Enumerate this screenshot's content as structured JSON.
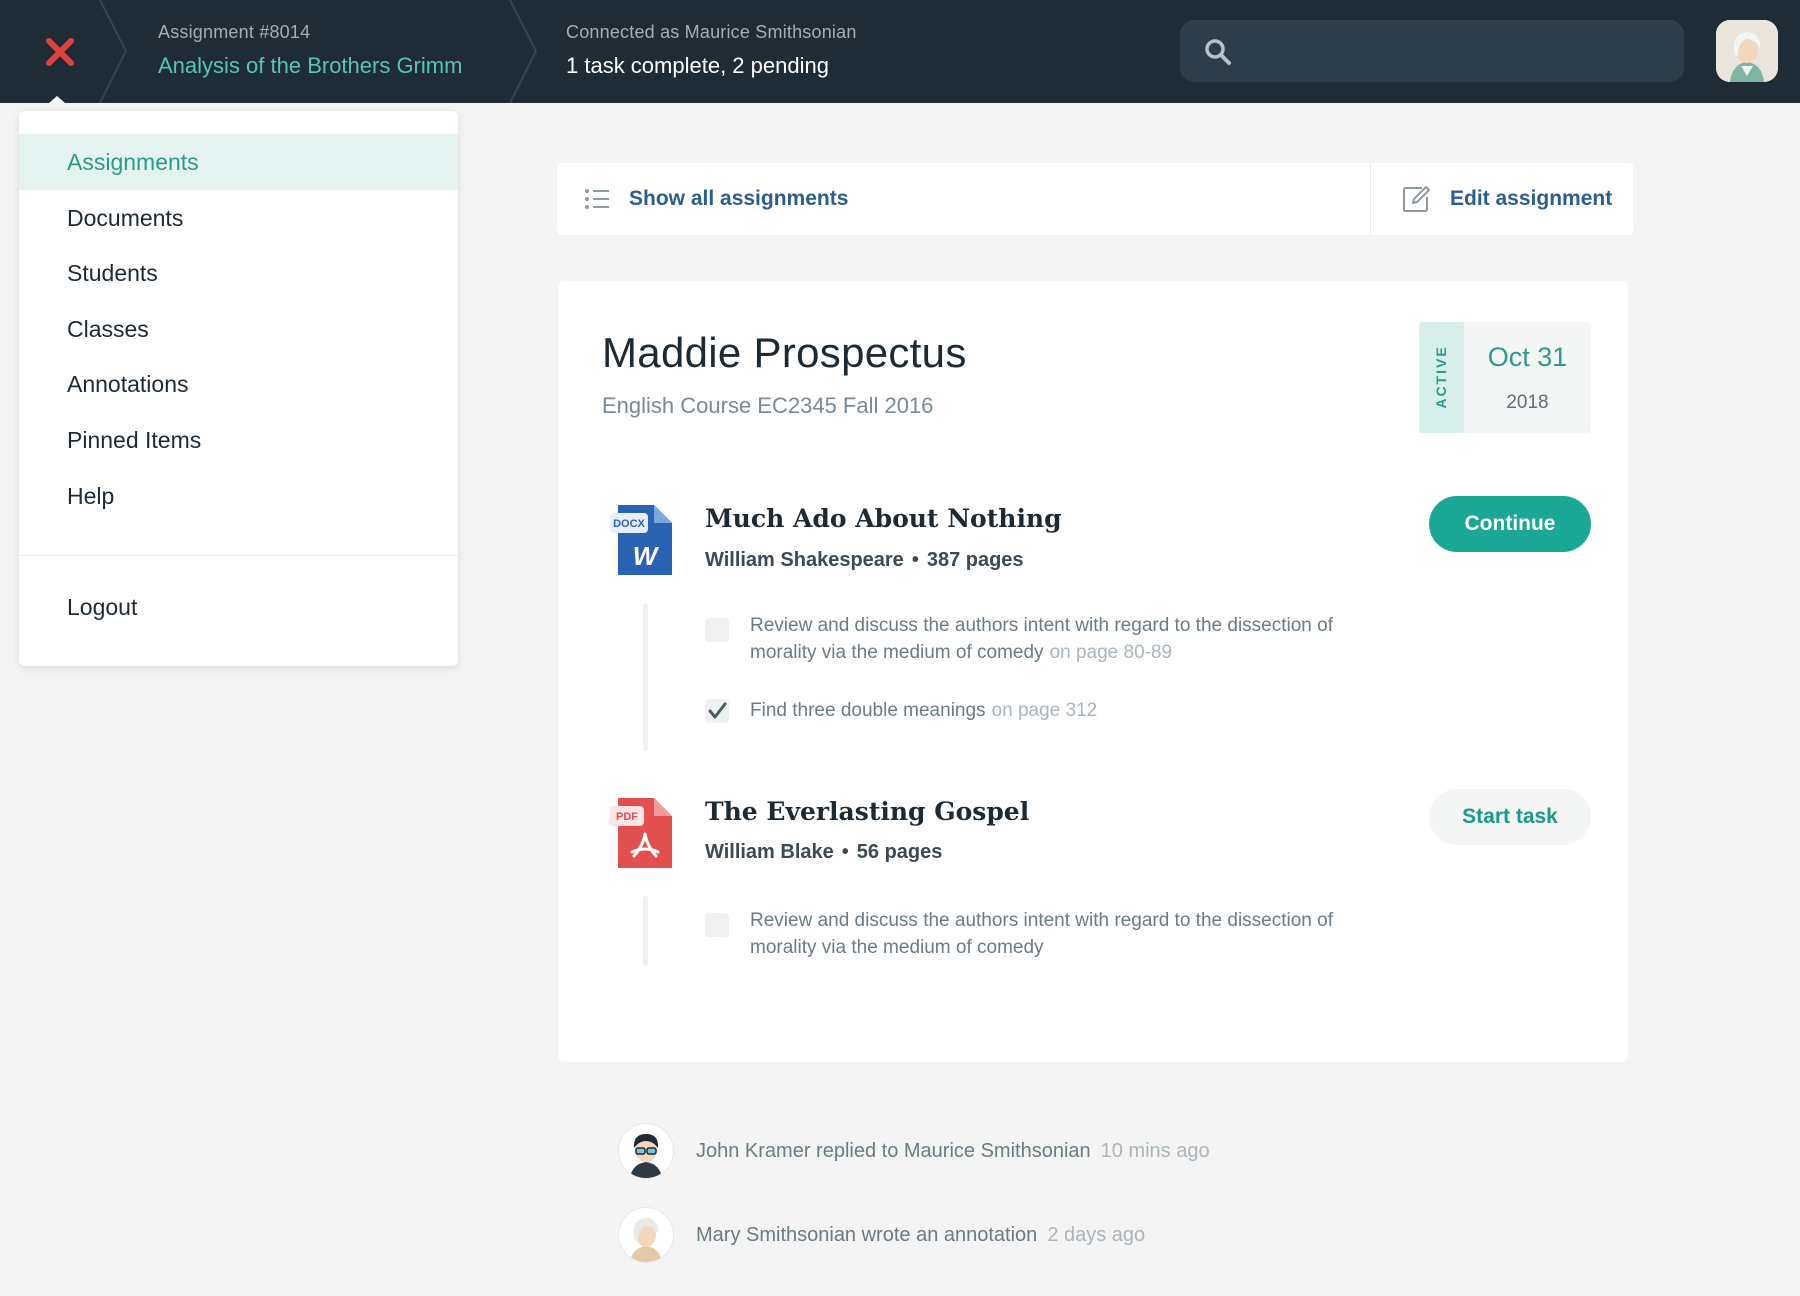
{
  "header": {
    "close_icon": "close-icon",
    "assignment_number": "Assignment #8014",
    "assignment_title": "Analysis of the Brothers Grimm",
    "connection_text": "Connected as Maurice Smithsonian",
    "task_status": "1 task complete, 2 pending",
    "search": {
      "placeholder": "",
      "value": "",
      "icon": "search-icon"
    },
    "avatar": "user-avatar",
    "colors": {
      "bar": "#1f2c36",
      "accent": "#55c5b5",
      "close": "#e0433b"
    }
  },
  "sidebar": {
    "items": [
      {
        "label": "Assignments",
        "active": true
      },
      {
        "label": "Documents"
      },
      {
        "label": "Students"
      },
      {
        "label": "Classes"
      },
      {
        "label": "Annotations"
      },
      {
        "label": "Pinned Items"
      },
      {
        "label": "Help"
      }
    ],
    "logout": "Logout"
  },
  "actionbar": {
    "show_all": "Show all assignments",
    "show_all_icon": "list-icon",
    "edit": "Edit assignment",
    "edit_icon": "edit-icon"
  },
  "assignment": {
    "title": "Maddie Prospectus",
    "course": "English Course EC2345 Fall 2016",
    "status": "ACTIVE",
    "date": "Oct 31",
    "year": "2018",
    "documents": [
      {
        "type_badge": "DOCX",
        "type_letter": "W",
        "title": "Much Ado About Nothing",
        "author": "William Shakespeare",
        "pages": "387 pages",
        "action": "Continue",
        "tasks": [
          {
            "text": "Review and discuss the authors intent with regard to the dissection of morality via the medium of comedy",
            "page": "on page 80-89",
            "checked": false
          },
          {
            "text": "Find three double meanings",
            "page": "on page 312",
            "checked": true
          }
        ]
      },
      {
        "type_badge": "PDF",
        "title": "The Everlasting Gospel",
        "author": "William Blake",
        "pages": "56 pages",
        "action": "Start task",
        "tasks": [
          {
            "text": "Review and discuss the authors intent with regard to the dissection of morality via the medium of comedy",
            "page": "",
            "checked": false
          }
        ]
      }
    ]
  },
  "activity": [
    {
      "text": "John Kramer replied to Maurice Smithsonian",
      "time": "10 mins ago"
    },
    {
      "text": "Mary Smithsonian wrote an annotation",
      "time": "2 days ago"
    }
  ],
  "dot": "•"
}
